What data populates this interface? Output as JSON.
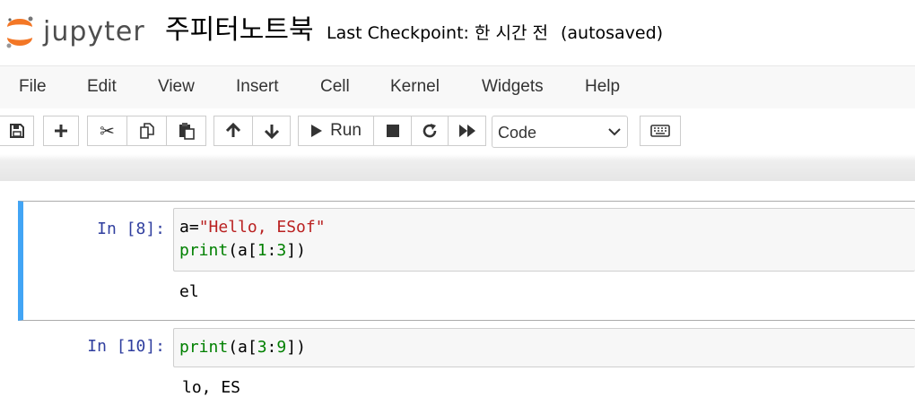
{
  "header": {
    "logo_text": "jupyter",
    "notebook_title": "주피터노트북",
    "checkpoint": "Last Checkpoint: 한 시간 전",
    "autosaved": "(autosaved)"
  },
  "menubar": {
    "items": [
      "File",
      "Edit",
      "View",
      "Insert",
      "Cell",
      "Kernel",
      "Widgets",
      "Help"
    ]
  },
  "toolbar": {
    "buttons": [
      "save-icon",
      "plus-icon",
      "cut-icon",
      "copy-icon",
      "paste-icon",
      "arrow-up-icon",
      "arrow-down-icon",
      "run-icon",
      "stop-icon",
      "restart-icon",
      "fast-forward-icon",
      "keyboard-icon"
    ],
    "run_label": "Run",
    "cell_type": "Code"
  },
  "cells": [
    {
      "prompt": "In [8]:",
      "code_lines": [
        [
          {
            "t": "a=",
            "c": ""
          },
          {
            "t": "\"Hello, ESof\"",
            "c": "str"
          }
        ],
        [
          {
            "t": "print",
            "c": "kw"
          },
          {
            "t": "(a[",
            "c": ""
          },
          {
            "t": "1",
            "c": "num"
          },
          {
            "t": ":",
            "c": ""
          },
          {
            "t": "3",
            "c": "num"
          },
          {
            "t": "])",
            "c": ""
          }
        ]
      ],
      "output": "el"
    },
    {
      "prompt": "In [10]:",
      "code_lines": [
        [
          {
            "t": "print",
            "c": "kw"
          },
          {
            "t": "(a[",
            "c": ""
          },
          {
            "t": "3",
            "c": "num"
          },
          {
            "t": ":",
            "c": ""
          },
          {
            "t": "9",
            "c": "num"
          },
          {
            "t": "])",
            "c": ""
          }
        ]
      ],
      "output": "lo, ES"
    }
  ],
  "colors": {
    "selected_cell_border": "#42a5f5",
    "prompt": "#303f9f",
    "string": "#ba2121",
    "keyword": "#008000"
  }
}
